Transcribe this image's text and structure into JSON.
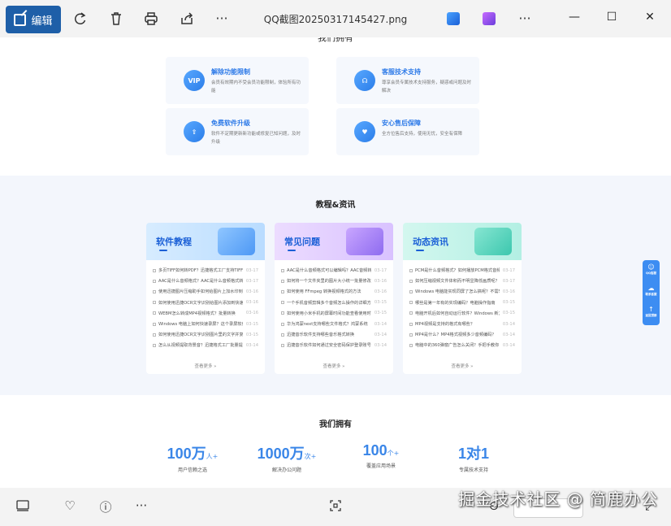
{
  "toolbar": {
    "edit_label": "编辑",
    "file_name": "QQ截图20250317145427.png",
    "more_label": "···"
  },
  "window": {
    "minimize": "—",
    "maximize": "☐",
    "close": "✕"
  },
  "features": {
    "heading": "我们拥有",
    "items": [
      {
        "title": "解除功能限制",
        "desc": "会员有效期内不受会员功能限制，体验所有功能",
        "badge": "VIP"
      },
      {
        "title": "客服技术支持",
        "desc": "尊享会员专属技术支持服务，疑惑或问题及时解决",
        "badge": "☊"
      },
      {
        "title": "免费软件升级",
        "desc": "软件不定期更新新功能或修复已知问题，及时升级",
        "badge": "⇧"
      },
      {
        "title": "安心售后保障",
        "desc": "全方位售后支持，使用无忧，安全有保障",
        "badge": "♥"
      }
    ]
  },
  "tutorials": {
    "title": "教程&资讯",
    "more": "查看更多 »",
    "cards": [
      {
        "title": "软件教程",
        "items": [
          {
            "t": "多页TIFF如何转PDF？迅捷格式工厂支持TIFF转换",
            "d": "03-17"
          },
          {
            "t": "AAC是什么音频格式？AAC是什么音频格式转换",
            "d": "03-17"
          },
          {
            "t": "使用迅捷图片压缩助手如何给图片上加水印到图片",
            "d": "03-16"
          },
          {
            "t": "如何使用迅捷OCR文字识别给图片添加到快速识别",
            "d": "03-16"
          },
          {
            "t": "WEBM怎么转成MP4视频格式？批量转换",
            "d": "03-16"
          },
          {
            "t": "Windows 电脑上如何快速录屏？这个录屏软件",
            "d": "03-15"
          },
          {
            "t": "如何使用迅捷OCR文字识别图片里的文字并复制",
            "d": "03-15"
          },
          {
            "t": "怎么从视频提取背景音？迅捷格式工厂批量提取",
            "d": "03-14"
          }
        ]
      },
      {
        "title": "常见问题",
        "items": [
          {
            "t": "AAC是什么音频格式可以编辑吗？AAC音频转换",
            "d": "03-17"
          },
          {
            "t": "如何将一个文件夹里的图片大小统一批量修改",
            "d": "03-16"
          },
          {
            "t": "如何使用 FFmpeg 转换视频格式的方法",
            "d": "03-16"
          },
          {
            "t": "一个手机音频剪辑多个音频怎么操作的详细方法",
            "d": "03-15"
          },
          {
            "t": "如何使用小米手机的屏幕时间功能查看使用时长",
            "d": "03-15"
          },
          {
            "t": "华为鸿蒙next支持哪些文件格式？鸿蒙系统",
            "d": "03-14"
          },
          {
            "t": "迅捷音乐软件支持哪些音乐格式转换",
            "d": "03-14"
          },
          {
            "t": "迅捷音乐软件如何通过安全密码保护登录账号",
            "d": "03-14"
          }
        ]
      },
      {
        "title": "动态资讯",
        "items": [
          {
            "t": "PCM是什么音频格式？如何播放PCM格式音频",
            "d": "03-17"
          },
          {
            "t": "如何压缩视频文件体积而不明显降低画质呢？",
            "d": "03-17"
          },
          {
            "t": "Windows 电脑能实现同屏了怎么搞呢？不需软件",
            "d": "03-16"
          },
          {
            "t": "哪些是第一年有的实现编码？电脑操作指南",
            "d": "03-15"
          },
          {
            "t": "电脑开机后如何自动运行软件？Windows 新方法",
            "d": "03-15"
          },
          {
            "t": "MP4视频是支持的格式有哪些？",
            "d": "03-14"
          },
          {
            "t": "MP4是什么？MP4格式视频多少音频编码？",
            "d": "03-14"
          },
          {
            "t": "电脑中的360弹窗广告怎么关闭？手把手教你",
            "d": "03-14"
          }
        ]
      }
    ]
  },
  "stats": {
    "title": "我们拥有",
    "items": [
      {
        "num": "100万",
        "unit": "人+",
        "desc": "用户信赖之选"
      },
      {
        "num": "1000万",
        "unit": "次+",
        "desc": "解决办公问题"
      },
      {
        "num": "100",
        "unit": "个+",
        "desc": "覆盖应用场景"
      },
      {
        "num": "1对1",
        "unit": "",
        "desc": "专属技术支持"
      }
    ]
  },
  "float_tool": [
    "QQ客服",
    "联系客服",
    "返回顶部"
  ],
  "watermark": "掘金技术社区 @ 简鹿办公",
  "colors": {
    "accent": "#1e5fa8",
    "link_blue": "#2d7ae8",
    "stat_blue": "#3a86e8"
  }
}
